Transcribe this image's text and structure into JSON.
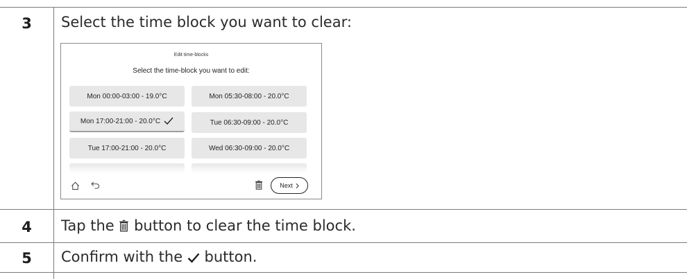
{
  "steps": [
    {
      "number": "3",
      "text": "Select the time block you want to clear:"
    },
    {
      "number": "4",
      "text_before": "Tap the",
      "icon": "trash-icon",
      "text_after": "button to clear the time block."
    },
    {
      "number": "5",
      "text_before": "Confirm with the",
      "icon": "checkmark-icon",
      "text_after": "button."
    }
  ],
  "screen": {
    "title": "Edit time-blocks",
    "subtitle": "Select the time-block you want to edit:",
    "time_blocks": [
      {
        "label": "Mon 00:00-03:00 - 19.0°C",
        "selected": false
      },
      {
        "label": "Mon  05:30-08:00 - 20.0°C",
        "selected": false
      },
      {
        "label": "Mon 17:00-21:00 - 20.0°C",
        "selected": true
      },
      {
        "label": "Tue  06:30-09:00 - 20.0°C",
        "selected": false
      },
      {
        "label": "Tue 17:00-21:00 - 20.0°C",
        "selected": false
      },
      {
        "label": "Wed  06:30-09:00 - 20.0°C",
        "selected": false
      }
    ],
    "next_label": "Next",
    "icons": [
      "home-icon",
      "back-icon",
      "trash-icon",
      "chevron-right-icon",
      "checkmark-icon"
    ]
  }
}
